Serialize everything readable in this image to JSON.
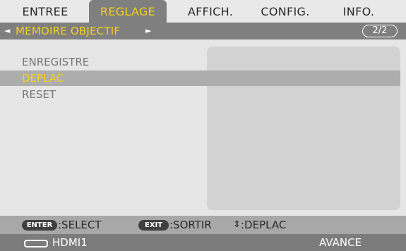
{
  "tabs": [
    {
      "label": "ENTREE",
      "active": false
    },
    {
      "label": "REGLAGE",
      "active": true
    },
    {
      "label": "AFFICH.",
      "active": false
    },
    {
      "label": "CONFIG.",
      "active": false
    },
    {
      "label": "INFO.",
      "active": false
    }
  ],
  "submenu": {
    "title": "MEMOIRE OBJECTIF",
    "left_arrow": "◄",
    "right_arrow": "►",
    "page": "2/2"
  },
  "menu_items": [
    {
      "label": "ENREGISTRE",
      "selected": false
    },
    {
      "label": "DEPLAC",
      "selected": true
    },
    {
      "label": "RESET",
      "selected": false
    }
  ],
  "guide": {
    "enter_key": "ENTER",
    "enter_label": ":SELECT",
    "exit_key": "EXIT",
    "exit_label": ":SORTIR",
    "move_icon": "⇕",
    "move_label": ":DEPLAC"
  },
  "status": {
    "source_icon": "hdmi-connector-icon",
    "source": "HDMI1",
    "mode": "AVANCE"
  },
  "colors": {
    "accent_yellow": "#f3d21c",
    "band_gray": "#7f7f7f",
    "highlight_gray": "#adadad",
    "background": "#e6e6e6"
  }
}
